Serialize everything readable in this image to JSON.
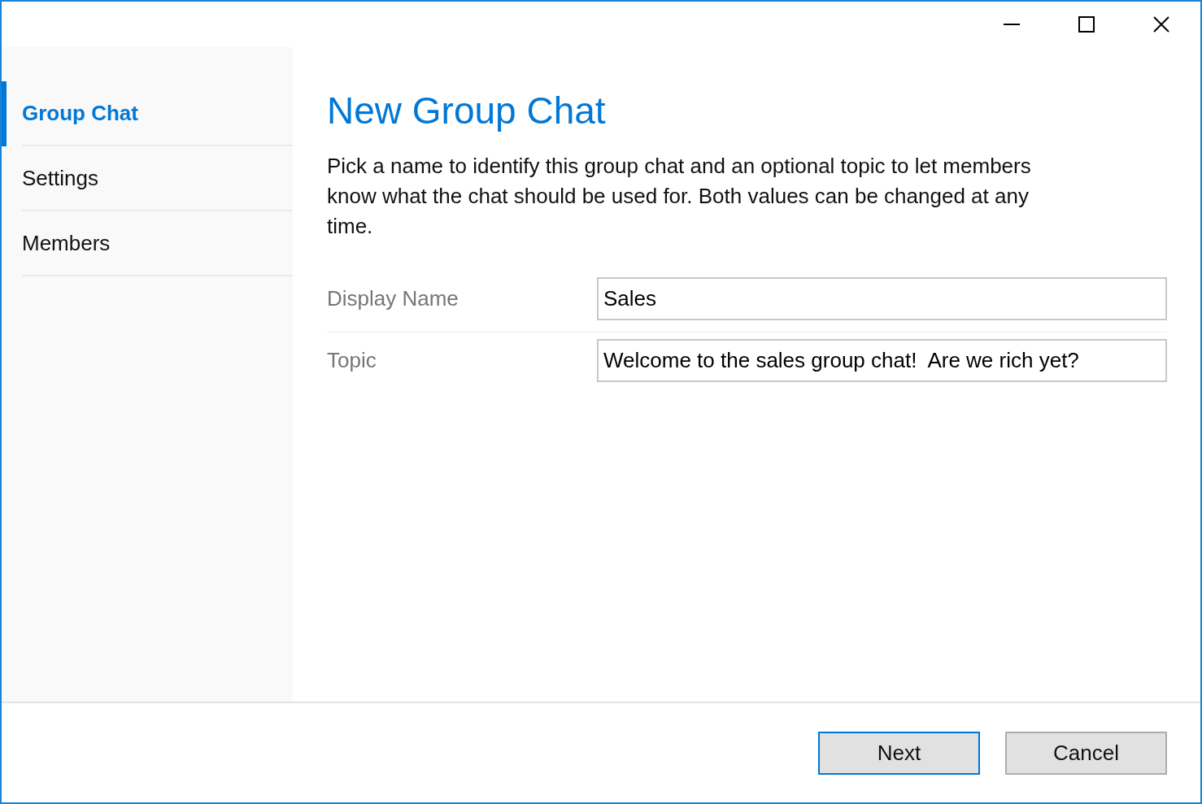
{
  "sidebar": {
    "items": [
      {
        "label": "Group Chat",
        "selected": true
      },
      {
        "label": "Settings",
        "selected": false
      },
      {
        "label": "Members",
        "selected": false
      }
    ]
  },
  "page": {
    "title": "New Group Chat",
    "description": "Pick a name to identify this group chat and an optional topic to let members know what the chat should be used for.  Both values can be changed at any time."
  },
  "fields": [
    {
      "label": "Display Name",
      "value": "Sales"
    },
    {
      "label": "Topic",
      "value": "Welcome to the sales group chat!  Are we rich yet?"
    }
  ],
  "buttons": [
    {
      "label": "Next",
      "default": true
    },
    {
      "label": "Cancel",
      "default": false
    }
  ]
}
